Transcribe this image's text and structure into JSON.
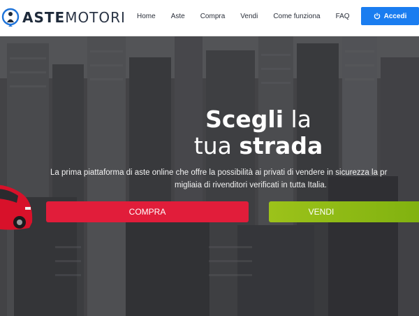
{
  "brand": {
    "name_bold": "ASTE",
    "name_light": "MOTORI",
    "icon": "person-pin-icon",
    "color_primary": "#1e2a3a",
    "color_accent": "#1a7df0"
  },
  "nav": {
    "items": [
      "Home",
      "Aste",
      "Compra",
      "Vendi",
      "Come funziona",
      "FAQ"
    ]
  },
  "login": {
    "label": "Accedi",
    "icon": "power-icon",
    "color": "#1a7df0"
  },
  "hero": {
    "title_line1_bold": "Scegli",
    "title_line1_rest": " la",
    "title_line2_light": "tua ",
    "title_line2_bold": "strada",
    "subtitle_line1": "La prima piattaforma di aste online che offre la possibilità ai privati di vendere in sicurezza la pr",
    "subtitle_line2": "migliaia di rivenditori verificati in tutta Italia.",
    "buttons": {
      "compra": "COMPRA",
      "vendi": "VENDI"
    },
    "colors": {
      "compra": "#e11d3a",
      "vendi": "#8dba12"
    }
  }
}
